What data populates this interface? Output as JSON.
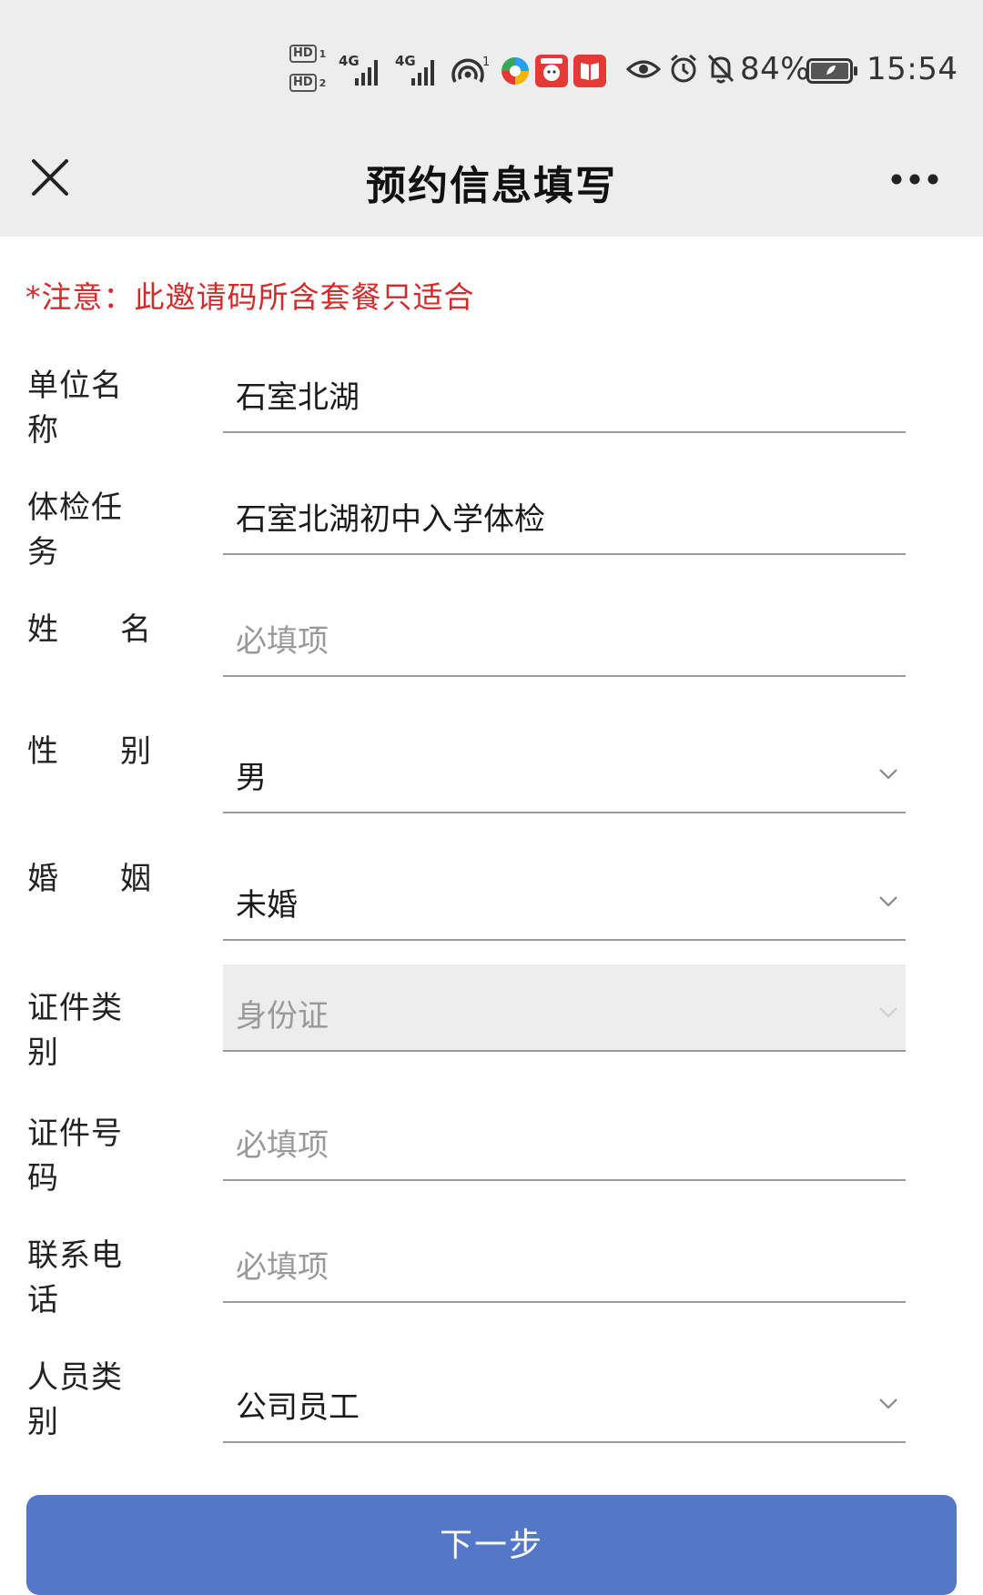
{
  "status_bar": {
    "hd1": "HD",
    "hd1_sim": "1",
    "hd2": "HD",
    "hd2_sim": "2",
    "net1": "4G",
    "net2": "4G",
    "hotspot_count": "1",
    "battery": "84%",
    "time": "15:54"
  },
  "header": {
    "title": "预约信息填写"
  },
  "notice": "*注意：此邀请码所含套餐只适合",
  "form": {
    "unit": {
      "label": "单位名称",
      "value": "石室北湖"
    },
    "task": {
      "label": "体检任务",
      "value": "石室北湖初中入学体检"
    },
    "name": {
      "label_a": "姓",
      "label_b": "名",
      "placeholder": "必填项"
    },
    "gender": {
      "label_a": "性",
      "label_b": "别",
      "value": "男"
    },
    "marital": {
      "label_a": "婚",
      "label_b": "姻",
      "value": "未婚"
    },
    "id_type": {
      "label": "证件类别",
      "value": "身份证"
    },
    "id_number": {
      "label": "证件号码",
      "placeholder": "必填项"
    },
    "phone": {
      "label": "联系电话",
      "placeholder": "必填项"
    },
    "person_type": {
      "label": "人员类别",
      "value": "公司员工"
    }
  },
  "next_button": "下一步",
  "colors": {
    "header_bg": "#ededed",
    "notice": "#d42a2a",
    "button": "#5577c8",
    "placeholder": "#999999"
  },
  "icons": {
    "close": "close-icon",
    "more": "more-icon",
    "dropdown": "chevron-down-icon"
  }
}
